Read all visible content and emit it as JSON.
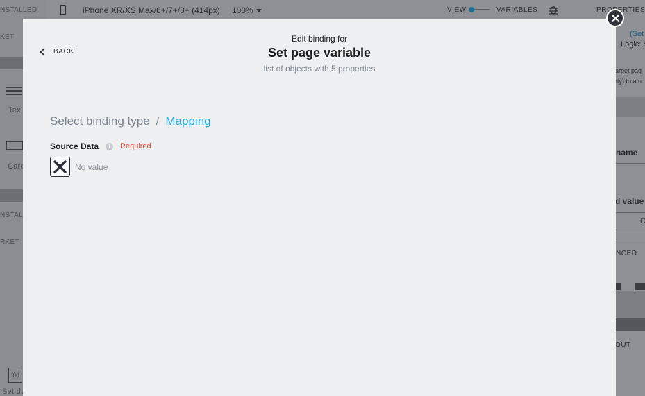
{
  "background": {
    "left_panel": {
      "installed_label": "NSTALLED",
      "market_label": "KET",
      "text_label": "Tex",
      "card_label": "Card",
      "installed_label_2": "NSTALL",
      "market_label_2": "RKET",
      "setdata_label": "Set da"
    },
    "topbar": {
      "device_label": "iPhone XR/XS Max/6+/7+/8+ (414px)",
      "zoom_label": "100%",
      "view_label": "VIEW",
      "variables_label": "VARIABLES"
    },
    "right_panel": {
      "properties_label": "PROPERTIES",
      "set_link": "(Set",
      "logic_text": "Logic: S",
      "desc_line_1": "arget pag",
      "desc_line_2": "rty) to a n",
      "name_label": "name",
      "value_label": "d value",
      "c_label": "C",
      "advanced_label": "NCED",
      "layout_label": "OUT"
    }
  },
  "modal": {
    "back_label": "BACK",
    "header_small": "Edit binding for",
    "header_title": "Set page variable",
    "header_subtitle": "list of objects with 5 properties",
    "breadcrumb": {
      "link": "Select binding type",
      "separator": "/",
      "current": "Mapping"
    },
    "field": {
      "label": "Source Data",
      "info_icon": "i",
      "required": "Required",
      "value_text": "No value"
    },
    "colors": {
      "accent": "#29a6d5",
      "required": "#e8423f",
      "modal_bg": "#eeeff1"
    }
  }
}
